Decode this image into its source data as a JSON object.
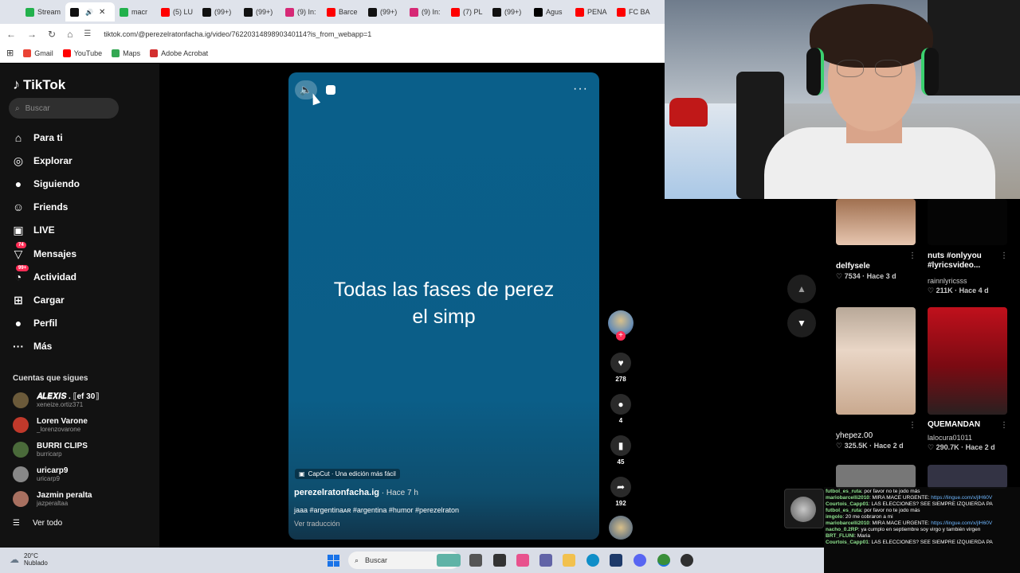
{
  "browser": {
    "tabs": [
      {
        "label": "Stream",
        "color": "#22b14c",
        "active": false
      },
      {
        "label": "",
        "color": "#111111",
        "active": true
      },
      {
        "label": "macr",
        "color": "#22b14c",
        "active": false
      },
      {
        "label": "(5) LU",
        "color": "#ff0000",
        "active": false
      },
      {
        "label": "(99+)",
        "color": "#111111",
        "active": false
      },
      {
        "label": "(99+)",
        "color": "#111111",
        "active": false
      },
      {
        "label": "(9) In:",
        "color": "#d62976",
        "active": false
      },
      {
        "label": "Barce",
        "color": "#ff0000",
        "active": false
      },
      {
        "label": "(99+)",
        "color": "#111111",
        "active": false
      },
      {
        "label": "(9) In:",
        "color": "#d62976",
        "active": false
      },
      {
        "label": "(7) PL",
        "color": "#ff0000",
        "active": false
      },
      {
        "label": "(99+)",
        "color": "#111111",
        "active": false
      },
      {
        "label": "Agus",
        "color": "#000000",
        "active": false
      },
      {
        "label": "PENA",
        "color": "#ff0000",
        "active": false
      },
      {
        "label": "FC BA",
        "color": "#ff0000",
        "active": false
      }
    ],
    "url": "tiktok.com/@perezelratonfacha.ig/video/7622031489890340114?is_from_webapp=1",
    "bookmarks": [
      {
        "label": "Gmail",
        "color": "#ea4335"
      },
      {
        "label": "YouTube",
        "color": "#ff0000"
      },
      {
        "label": "Maps",
        "color": "#34a853"
      },
      {
        "label": "Adobe Acrobat",
        "color": "#d32f2f"
      }
    ]
  },
  "tiktok": {
    "logo": "TikTok",
    "search_placeholder": "Buscar",
    "nav": [
      {
        "label": "Para ti",
        "icon": "home-icon",
        "glyph": "⌂"
      },
      {
        "label": "Explorar",
        "icon": "compass-icon",
        "glyph": "◎"
      },
      {
        "label": "Siguiendo",
        "icon": "following-icon",
        "glyph": "●"
      },
      {
        "label": "Friends",
        "icon": "friends-icon",
        "glyph": "☺"
      },
      {
        "label": "LIVE",
        "icon": "live-icon",
        "glyph": "▣"
      },
      {
        "label": "Mensajes",
        "icon": "messages-icon",
        "glyph": "▽",
        "badge": "74"
      },
      {
        "label": "Actividad",
        "icon": "activity-icon",
        "glyph": "◔",
        "badge": "99+"
      },
      {
        "label": "Cargar",
        "icon": "upload-icon",
        "glyph": "⊞"
      },
      {
        "label": "Perfil",
        "icon": "profile-icon",
        "glyph": "●"
      },
      {
        "label": "Más",
        "icon": "more-icon",
        "glyph": "···"
      }
    ],
    "following_title": "Cuentas que sigues",
    "accounts": [
      {
        "name": "𝑨𝑳𝑬𝑿𝑰𝑺 . ⟦ef 30⟧",
        "handle": "xeneize.ortiz371",
        "color": "#6b5a3a"
      },
      {
        "name": "Loren Varone",
        "handle": "_lorenzovarone",
        "color": "#c0392b"
      },
      {
        "name": "BURRI CLIPS",
        "handle": "burricarp",
        "color": "#4a6a3a"
      },
      {
        "name": "uricarp9",
        "handle": "uricarp9",
        "color": "#888888"
      },
      {
        "name": "Jazmin peralta",
        "handle": "jazperaltaa",
        "color": "#a87060"
      }
    ],
    "see_all": "Ver todo"
  },
  "video": {
    "overlay_text_line1": "Todas las fases de perez",
    "overlay_text_line2": "el simp",
    "capcut": "CapCut · Una edición más fácil",
    "author": "perezelratonfacha.ig",
    "posted": " · Hace 7 h",
    "caption": "jaaa #argentinaᴀʀ #argentina #humor #perezelraton",
    "translate": "Ver traducción",
    "likes": "278",
    "comments": "4",
    "saves": "45",
    "shares": "192"
  },
  "related": [
    {
      "title": "delfysele",
      "stats": "♡ 7534 · Hace 3 d"
    },
    {
      "title": "nuts #onlyyou #lyricsvideo...",
      "author": "rainnlyricsss",
      "stats": "♡ 211K · Hace 4 d"
    },
    {
      "title": "yhepez.00",
      "stats": "♡ 325.5K · Hace 2 d"
    },
    {
      "title": "QUEMANDAN",
      "author": "lalocura01011",
      "stats": "♡ 290.7K · Hace 2 d"
    }
  ],
  "chat": [
    {
      "user": "futbol_es_ruta",
      "text": ": por favor no te jodo más"
    },
    {
      "user": "mariobarcelli2010",
      "text": ": MIRA MACE URGENTE: ",
      "link": "https://lingue.com/x/jlH60V"
    },
    {
      "user": "Courtois_Capp01",
      "text": ": LAS ELECCIONES? SEE SIEMPRE IZQUIERDA PA"
    },
    {
      "user": "futbol_es_ruta",
      "text": ": por favor no te jodo más"
    },
    {
      "user": "imgolo",
      "text": ": 20 me cobraron a mi"
    },
    {
      "user": "mariobarcelli2010",
      "text": ": MIRA MACE URGENTE: ",
      "link": "https://lingue.com/x/jlH60V"
    },
    {
      "user": "nacho_0.2RP",
      "text": ": ya cumplo en septiembre soy virgo y también virgen"
    },
    {
      "user": "BRT_FLUNI",
      "text": ": Maria"
    },
    {
      "user": "Courtois_Capp01",
      "text": ": LAS ELECCIONES? SEE SIEMPRE IZQUIERDA PA"
    }
  ],
  "taskbar": {
    "temp": "20°C",
    "condition": "Nublado",
    "search": "Buscar"
  }
}
